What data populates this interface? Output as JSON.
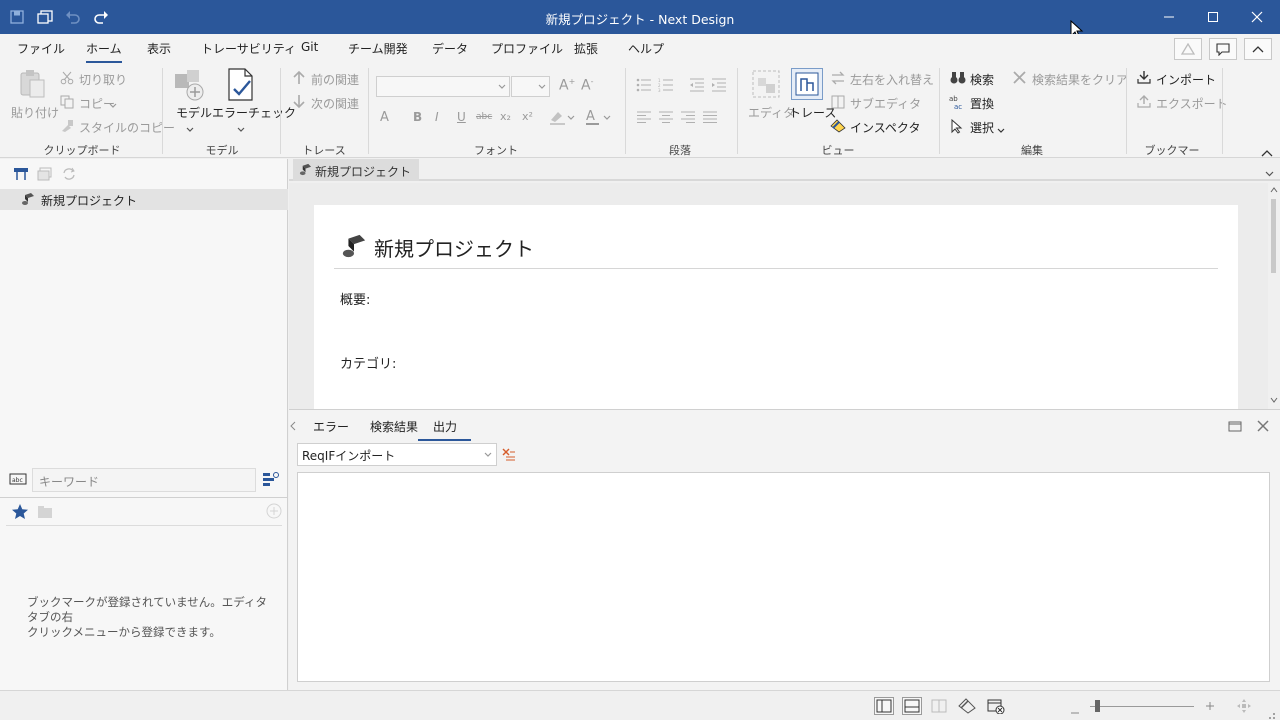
{
  "window": {
    "title": "新規プロジェクト - Next Design",
    "quick_access": [
      "save-icon",
      "save-all-icon",
      "undo-icon",
      "redo-icon"
    ],
    "controls": [
      "minimize-icon",
      "maximize-icon",
      "close-icon"
    ]
  },
  "menu": {
    "tabs": [
      "ファイル",
      "ホーム",
      "表示",
      "トレーサビリティ",
      "Git",
      "チーム開発",
      "データ",
      "プロファイル",
      "拡張",
      "ヘルプ"
    ],
    "active_tab": "ホーム"
  },
  "ribbon": {
    "clipboard": {
      "paste": "貼り付け",
      "cut": "切り取り",
      "copy": "コピー",
      "style_copy": "スタイルのコピー",
      "label": "クリップボード"
    },
    "model": {
      "model": "モデル",
      "error_check": "エラーチェック",
      "label": "モデル"
    },
    "trace": {
      "prev": "前の関連",
      "next": "次の関連",
      "label": "トレース"
    },
    "font": {
      "label": "フォント",
      "bold": "B",
      "italic": "I",
      "underline": "U",
      "strike": "abc",
      "sub": "x₂",
      "sup": "x²"
    },
    "paragraph": {
      "label": "段落"
    },
    "view": {
      "editor": "エディタ",
      "trace": "トレース",
      "swap": "左右を入れ替え",
      "sub_editor": "サブエディタ",
      "inspector": "インスペクタ",
      "label": "ビュー"
    },
    "edit": {
      "search": "検索",
      "clear_results": "検索結果をクリア",
      "replace": "置換",
      "select": "選択",
      "label": "編集"
    },
    "bookmark": {
      "import": "インポート",
      "export": "エクスポート",
      "label": "ブックマーク"
    }
  },
  "left_panel": {
    "tree_root": "新規プロジェクト",
    "search_placeholder": "キーワード",
    "bookmark_empty_line1": "ブックマークが登録されていません。エディタタブの右",
    "bookmark_empty_line2": "クリックメニューから登録できます。"
  },
  "document": {
    "tab": "新規プロジェクト",
    "title": "新規プロジェクト",
    "field_overview": "概要:",
    "field_category": "カテゴリ:"
  },
  "output_panel": {
    "tabs": [
      "エラー",
      "検索結果",
      "出力"
    ],
    "active_tab": "出力",
    "source_selected": "ReqIFインポート"
  },
  "colors": {
    "titlebar": "#2b579a",
    "accent": "#2b579a"
  }
}
